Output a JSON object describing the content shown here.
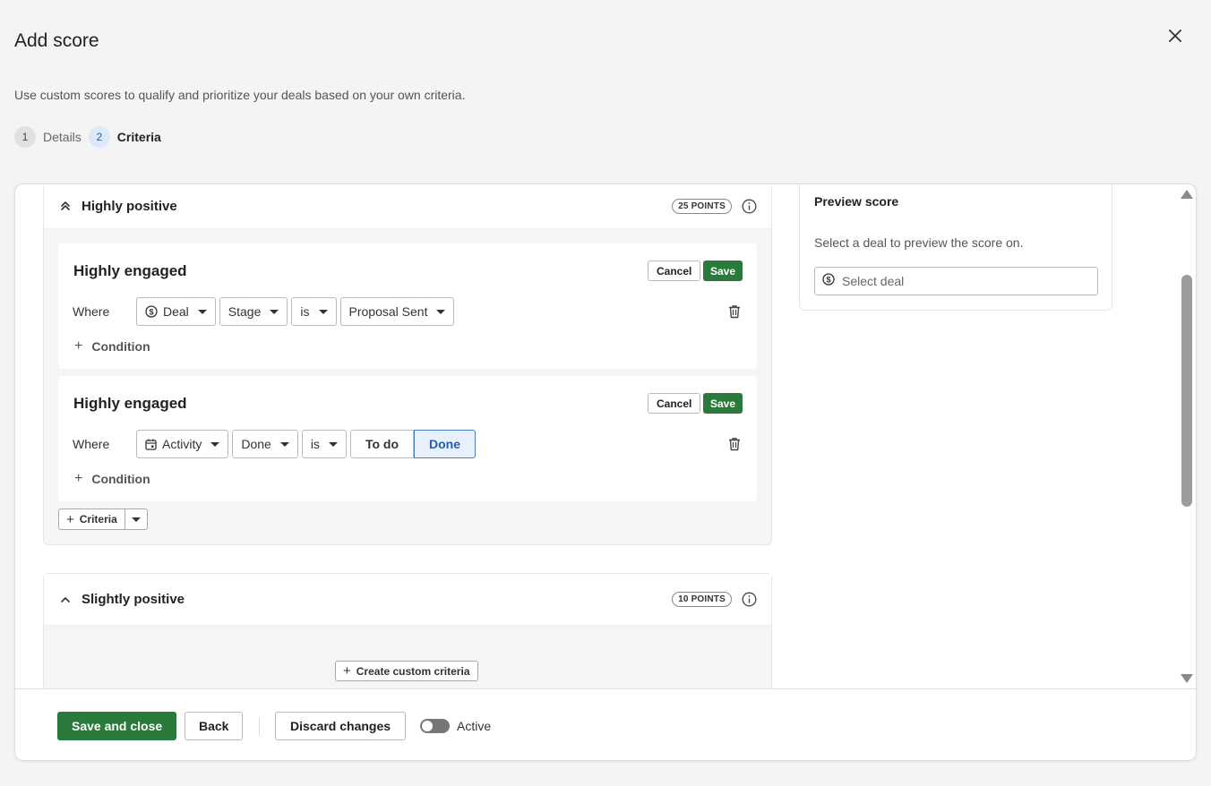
{
  "header": {
    "title": "Add score",
    "subtitle": "Use custom scores to qualify and prioritize your deals based on your own criteria."
  },
  "steps": [
    {
      "num": "1",
      "label": "Details"
    },
    {
      "num": "2",
      "label": "Criteria"
    }
  ],
  "groups": {
    "highly_positive": {
      "title": "Highly positive",
      "points": "25 POINTS",
      "cards": [
        {
          "title": "Highly engaged",
          "cancel": "Cancel",
          "save": "Save",
          "where": "Where",
          "entity": "Deal",
          "field": "Stage",
          "operator": "is",
          "value": "Proposal Sent",
          "condition": "Condition"
        },
        {
          "title": "Highly engaged",
          "cancel": "Cancel",
          "save": "Save",
          "where": "Where",
          "entity": "Activity",
          "field": "Done",
          "operator": "is",
          "toggle_left": "To do",
          "toggle_right": "Done",
          "condition": "Condition"
        }
      ],
      "add_criteria": "Criteria"
    },
    "slightly_positive": {
      "title": "Slightly positive",
      "points": "10 POINTS",
      "create_custom": "Create custom criteria"
    }
  },
  "preview": {
    "title": "Preview score",
    "description": "Select a deal to preview the score on.",
    "placeholder": "Select deal"
  },
  "footer": {
    "save_close": "Save and close",
    "back": "Back",
    "discard": "Discard changes",
    "active_label": "Active",
    "active": false
  },
  "colors": {
    "primary_green": "#2a7a3b",
    "selected_blue": "#2a5da8"
  }
}
